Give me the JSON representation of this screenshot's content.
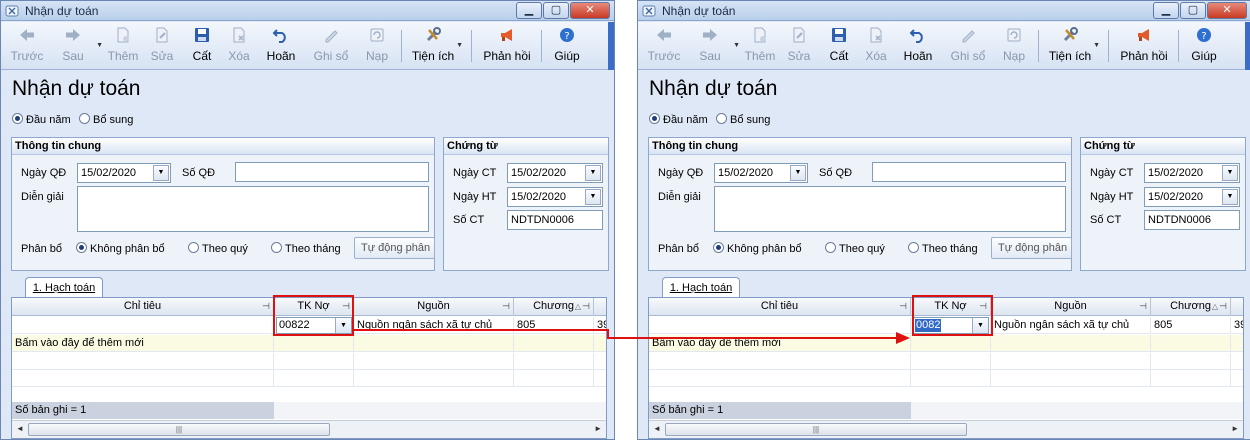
{
  "window_title": "Nhận dự toán",
  "toolbar": [
    {
      "key": "prev",
      "label": "Trước",
      "icon": "arrow-left-icon",
      "disabled": true
    },
    {
      "key": "next",
      "label": "Sau",
      "icon": "arrow-right-icon",
      "disabled": true
    },
    {
      "key": "add",
      "label": "Thêm",
      "icon": "new-document-icon",
      "disabled": true
    },
    {
      "key": "edit",
      "label": "Sửa",
      "icon": "edit-document-icon",
      "disabled": true
    },
    {
      "key": "save",
      "label": "Cất",
      "icon": "floppy-disk-icon",
      "disabled": false
    },
    {
      "key": "delete",
      "label": "Xóa",
      "icon": "delete-document-icon",
      "disabled": true
    },
    {
      "key": "undo",
      "label": "Hoãn",
      "icon": "undo-icon",
      "disabled": false
    },
    {
      "key": "post",
      "label": "Ghi sổ",
      "icon": "pencil-icon",
      "disabled": true
    },
    {
      "key": "load",
      "label": "Nạp",
      "icon": "reload-icon",
      "disabled": true
    },
    {
      "key": "utilities",
      "label": "Tiện ích",
      "icon": "tools-icon",
      "disabled": false
    },
    {
      "key": "feedback",
      "label": "Phản hồi",
      "icon": "megaphone-icon",
      "disabled": false
    },
    {
      "key": "help",
      "label": "Giúp",
      "icon": "help-icon",
      "disabled": false
    }
  ],
  "page_title": "Nhận dự toán",
  "mode_options": [
    {
      "label": "Đầu năm",
      "checked": true
    },
    {
      "label": "Bổ sung",
      "checked": false
    }
  ],
  "general_info": {
    "heading": "Thông tin chung",
    "decision_date_label": "Ngày QĐ",
    "decision_date": "15/02/2020",
    "decision_no_label": "Số QĐ",
    "decision_no": "",
    "description_label": "Diễn giải",
    "description": "",
    "allocation_label": "Phân bổ",
    "allocation_options": [
      {
        "label": "Không phân bổ",
        "checked": true
      },
      {
        "label": "Theo quý",
        "checked": false
      },
      {
        "label": "Theo tháng",
        "checked": false
      }
    ],
    "auto_allocate_label": "Tự động phân b"
  },
  "voucher": {
    "heading": "Chứng từ",
    "voucher_date_label": "Ngày CT",
    "voucher_date": "15/02/2020",
    "accounting_date_label": "Ngày HT",
    "accounting_date": "15/02/2020",
    "voucher_no_label": "Số CT",
    "voucher_no": "NDTDN0006"
  },
  "tab_label": "1. Hạch toán",
  "grid": {
    "columns": [
      "Chỉ tiêu",
      "TK Nợ",
      "Nguồn",
      "Chương"
    ],
    "row": {
      "chi_tieu": "",
      "nguon": "Nguồn ngân sách xã tự chủ",
      "chuong": "805",
      "extra": "39"
    },
    "add_row_text": "Bấm vào đây để thêm mới",
    "record_count": "Số bản ghi = 1"
  },
  "left_panel": {
    "tk_no_value": "00822"
  },
  "right_panel": {
    "tk_no_value": "0082"
  },
  "colors": {
    "highlight": "#e01010",
    "selection": "#3169c6"
  }
}
